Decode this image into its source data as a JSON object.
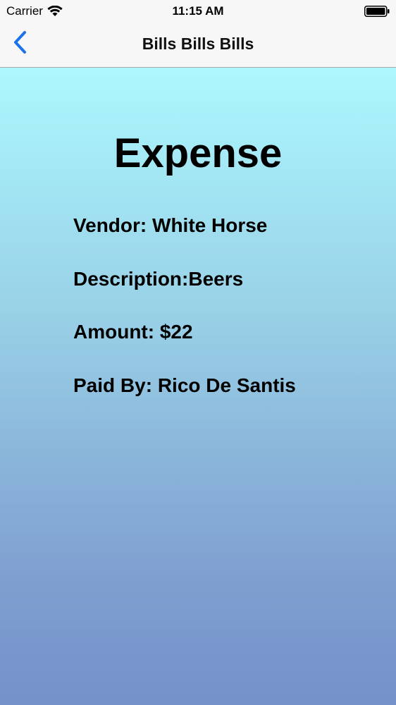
{
  "status_bar": {
    "carrier": "Carrier",
    "time": "11:15 AM",
    "icons": [
      "wifi-icon",
      "battery-icon"
    ]
  },
  "nav_bar": {
    "back_icon": "chevron-left-icon",
    "title": "Bills Bills Bills",
    "accent_color": "#1a73e8"
  },
  "main": {
    "heading": "Expense",
    "details": [
      {
        "label": "Vendor: ",
        "value": "White Horse"
      },
      {
        "label": "Description:",
        "value": "Beers"
      },
      {
        "label": "Amount: ",
        "value": "$22"
      },
      {
        "label": "Paid By: ",
        "value": "Rico De Santis"
      }
    ]
  },
  "colors": {
    "gradient_top": "#acf8fe",
    "gradient_bottom": "#7591ca",
    "bar_background": "#f7f7f8"
  }
}
